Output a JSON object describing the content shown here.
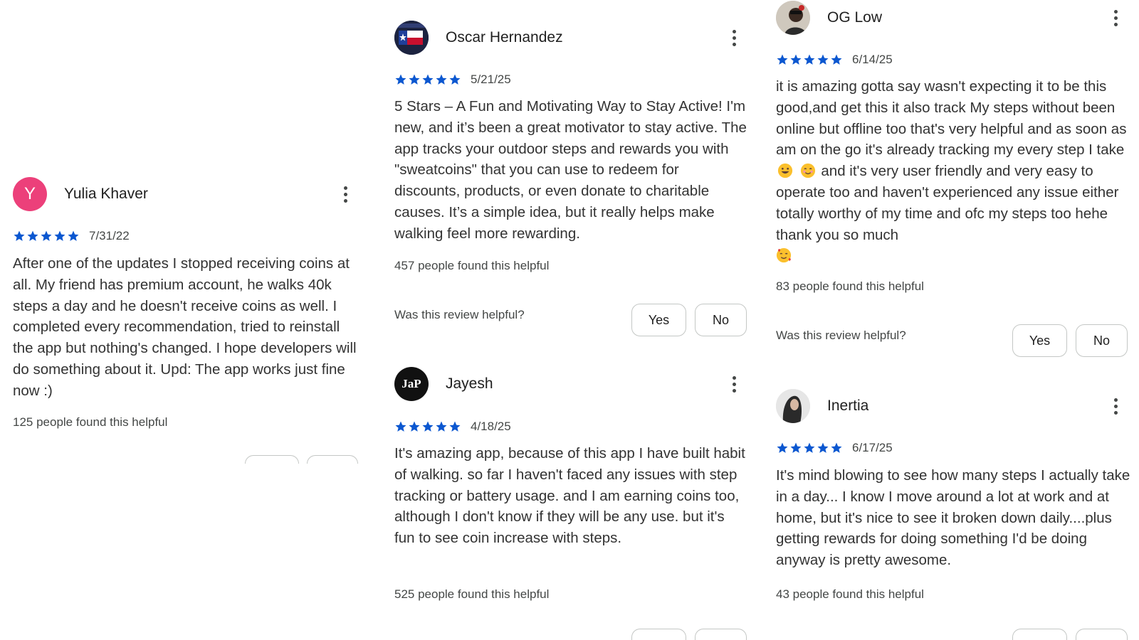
{
  "colors": {
    "star": "#0b57d0",
    "text": "#1f1f1f",
    "muted": "#444746",
    "button_border": "#c4c7c5",
    "avatar_pink": "#ec407a"
  },
  "reviews": [
    {
      "author": "Yulia Khaver",
      "avatar_letter": "Y",
      "rating": 5,
      "date": "7/31/22",
      "text": "After one of the updates I stopped receiving coins at all. My friend has premium account, he walks 40k steps a day and he doesn't receive coins as well. I completed every recommendation, tried to reinstall the app but nothing's changed. I hope developers will do something about it. Upd: The app works just fine now :)",
      "helpful_count": "125 people found this helpful"
    },
    {
      "author": "Oscar Hernandez",
      "avatar_icon": "texas-flag-avatar",
      "rating": 5,
      "date": "5/21/25",
      "text": "5 Stars – A Fun and Motivating Way to Stay Active! I'm new, and it’s been a great motivator to stay active. The app tracks your outdoor steps and rewards you with \"sweatcoins\" that you can use to redeem for discounts, products, or even donate to charitable causes. It’s a simple idea, but it really helps make walking feel more rewarding.",
      "helpful_count": "457 people found this helpful",
      "question": "Was this review helpful?",
      "yes": "Yes",
      "no": "No"
    },
    {
      "author": "Jayesh",
      "avatar_text": "JaP",
      "rating": 5,
      "date": "4/18/25",
      "text": "It's amazing app, because of this app I have built habit of walking. so far I haven't faced any issues with step tracking or battery usage. and I am earning coins too, although I don't know if they will be any use. but it's fun to see coin increase with steps.",
      "helpful_count": "525 people found this helpful"
    },
    {
      "author": "OG Low",
      "avatar_icon": "person-photo-avatar",
      "rating": 5,
      "date": "6/14/25",
      "text_before": "it is amazing gotta say wasn't expecting it to be this good,and get this it also track My steps without been online but offline too that's very helpful and as soon as am on the go it's already tracking my every step I take",
      "text_middle": "and it's very user friendly and very easy to operate too and haven't experienced any issue either totally worthy of my time and ofc my steps too hehe thank you so much",
      "helpful_count": "83 people found this helpful",
      "question": "Was this review helpful?",
      "yes": "Yes",
      "no": "No"
    },
    {
      "author": "Inertia",
      "avatar_icon": "person-photo-avatar",
      "rating": 5,
      "date": "6/17/25",
      "text": "It's mind blowing to see how many steps I actually take in a day... I know I move around a lot at work and at home, but it's nice to see it broken down daily....plus getting rewards for doing something I'd be doing anyway is pretty awesome.",
      "helpful_count": "43 people found this helpful"
    }
  ]
}
